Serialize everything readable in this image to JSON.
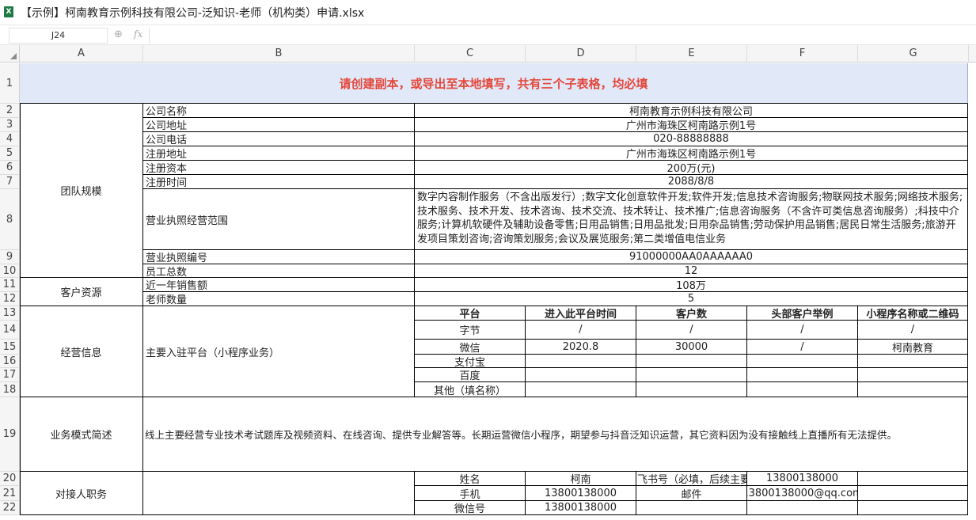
{
  "window": {
    "icon": "X",
    "title": "【示例】柯南教育示例科技有限公司-泛知识-老师（机构类）申请.xlsx"
  },
  "formula_bar": {
    "cell_ref": "J24",
    "zoom_icon": "magnifier-icon",
    "fx_label": "fx",
    "value": ""
  },
  "columns": [
    "A",
    "B",
    "C",
    "D",
    "E",
    "F",
    "G"
  ],
  "rows": [
    "1",
    "2",
    "3",
    "4",
    "5",
    "6",
    "7",
    "8",
    "9",
    "10",
    "11",
    "12",
    "13",
    "14",
    "15",
    "16",
    "17",
    "18",
    "19",
    "20",
    "21",
    "22"
  ],
  "sheet": {
    "banner": "请创建副本，或导出至本地填写，共有三个子表格，均必填",
    "sections": {
      "team": "团队规模",
      "customers": "客户资源",
      "operations": "经营信息",
      "business_model": "业务模式简述",
      "contact": "对接人职务"
    },
    "company": [
      {
        "label": "公司名称",
        "value": "柯南教育示例科技有限公司"
      },
      {
        "label": "公司地址",
        "value": "广州市海珠区柯南路示例1号"
      },
      {
        "label": "公司电话",
        "value": "020-88888888"
      },
      {
        "label": "注册地址",
        "value": "广州市海珠区柯南路示例1号"
      },
      {
        "label": "注册资本",
        "value": "200万(元)"
      },
      {
        "label": "注册时间",
        "value": "2088/8/8"
      }
    ],
    "scope_label": "营业执照经营范围",
    "scope_value": "数字内容制作服务（不含出版发行）;数字文化创意软件开发;软件开发;信息技术咨询服务;物联网技术服务;网络技术服务;技术服务、技术开发、技术咨询、技术交流、技术转让、技术推广;信息咨询服务（不含许可类信息咨询服务）;科技中介服务;计算机软硬件及辅助设备零售;日用品销售;日用品批发;日用杂品销售;劳动保护用品销售;居民日常生活服务;旅游开发项目策划咨询;咨询策划服务;会议及展览服务;第二类增值电信业务",
    "license": {
      "label": "营业执照编号",
      "value": "91000000AA0AAAAAA0"
    },
    "staff": {
      "label": "员工总数",
      "value": "12"
    },
    "sales": {
      "label": "近一年销售额",
      "value": "108万"
    },
    "teachers": {
      "label": "老师数量",
      "value": "5"
    },
    "platform_label": "主要入驻平台（小程序业务）",
    "platform_headers": [
      "平台",
      "进入此平台时间",
      "客户数",
      "头部客户举例",
      "小程序名称或二维码"
    ],
    "platforms": [
      [
        "字节",
        "/",
        "/",
        "/",
        "/"
      ],
      [
        "微信",
        "2020.8",
        "30000",
        "/",
        "柯南教育"
      ],
      [
        "支付宝",
        "",
        "",
        "",
        ""
      ],
      [
        "百度",
        "",
        "",
        "",
        ""
      ],
      [
        "其他（填名称）",
        "",
        "",
        "",
        ""
      ]
    ],
    "business_desc": "线上主要经营专业技术考试题库及视频资料、在线咨询、提供专业解答等。长期运营微信小程序，期望参与抖音泛知识运营，其它资料因为没有接触线上直播所有无法提供。",
    "contact": {
      "name_label": "姓名",
      "name_value": "柯南",
      "feishu_label": "飞书号（必填，后续主要",
      "feishu_value": "13800138000",
      "phone_label": "手机",
      "phone_value": "13800138000",
      "email_label": "邮件",
      "email_value": "13800138000@qq.com",
      "wechat_label": "微信号",
      "wechat_value": "13800138000"
    }
  }
}
